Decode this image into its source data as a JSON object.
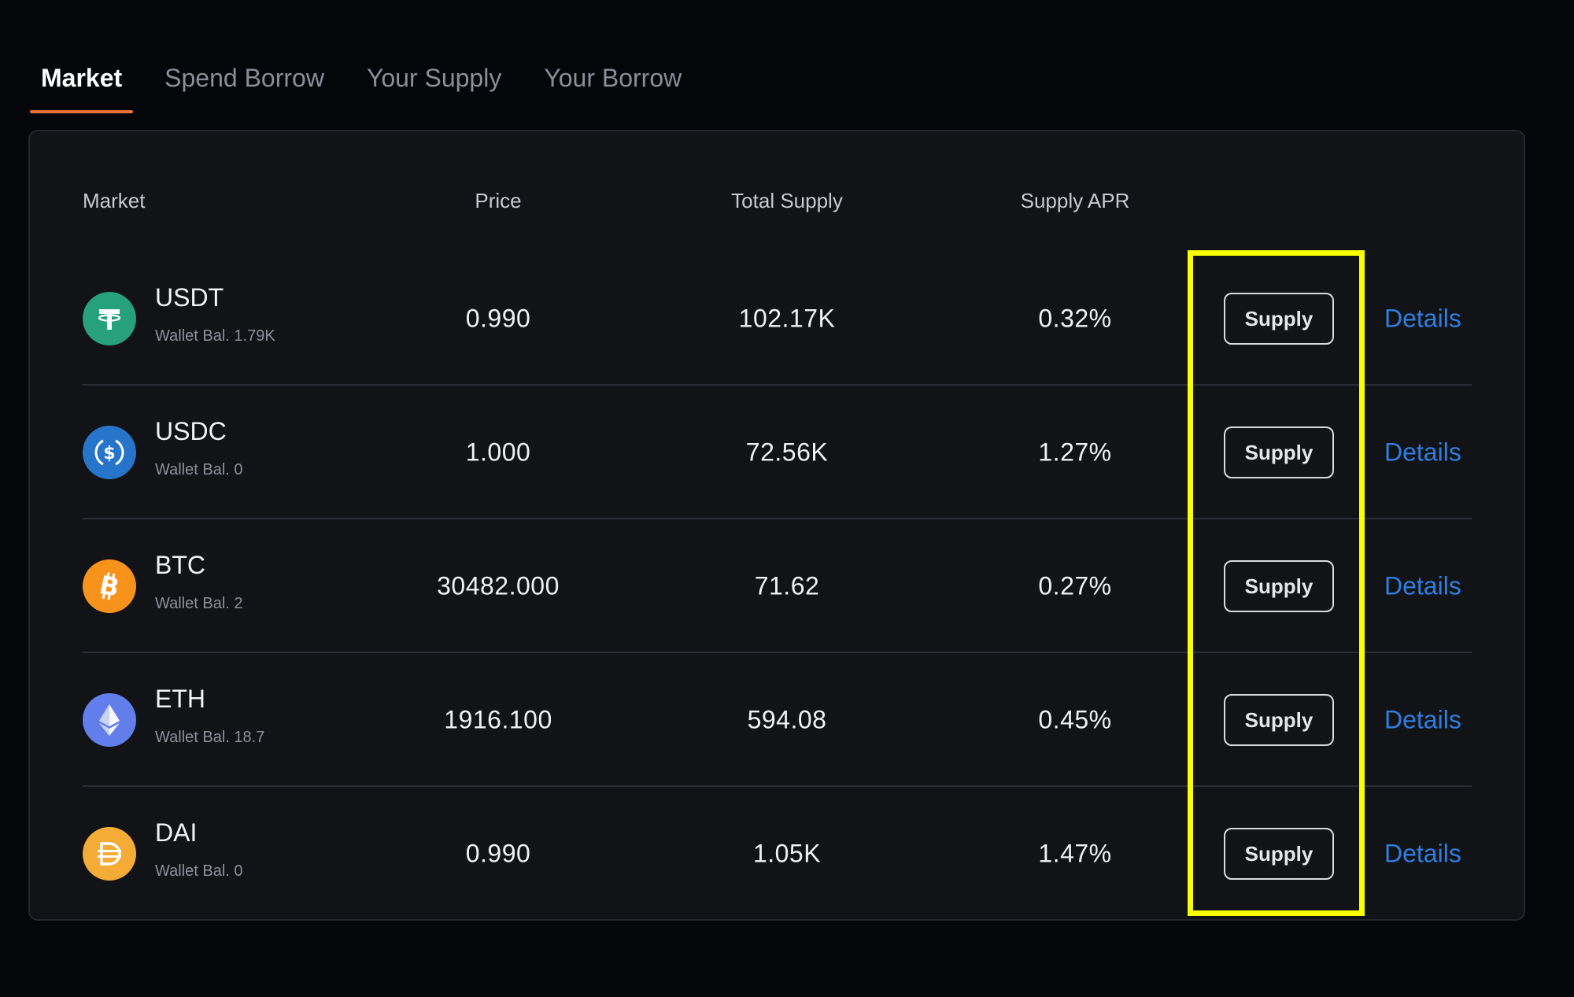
{
  "tabs": [
    {
      "label": "Market",
      "active": true
    },
    {
      "label": "Spend Borrow",
      "active": false
    },
    {
      "label": "Your Supply",
      "active": false
    },
    {
      "label": "Your Borrow",
      "active": false
    }
  ],
  "table": {
    "headers": {
      "market": "Market",
      "price": "Price",
      "total_supply": "Total Supply",
      "supply_apr": "Supply APR"
    },
    "rows": [
      {
        "symbol": "USDT",
        "wallet": "Wallet Bal. 1.79K",
        "price": "0.990",
        "total_supply": "102.17K",
        "apr": "0.32%",
        "action": "Supply",
        "link": "Details",
        "icon": "tether-icon",
        "color": "#26a17b"
      },
      {
        "symbol": "USDC",
        "wallet": "Wallet Bal. 0",
        "price": "1.000",
        "total_supply": "72.56K",
        "apr": "1.27%",
        "action": "Supply",
        "link": "Details",
        "icon": "usdc-icon",
        "color": "#2775ca"
      },
      {
        "symbol": "BTC",
        "wallet": "Wallet Bal. 2",
        "price": "30482.000",
        "total_supply": "71.62",
        "apr": "0.27%",
        "action": "Supply",
        "link": "Details",
        "icon": "bitcoin-icon",
        "color": "#f7931a"
      },
      {
        "symbol": "ETH",
        "wallet": "Wallet Bal. 18.7",
        "price": "1916.100",
        "total_supply": "594.08",
        "apr": "0.45%",
        "action": "Supply",
        "link": "Details",
        "icon": "ethereum-icon",
        "color": "#627eea"
      },
      {
        "symbol": "DAI",
        "wallet": "Wallet Bal. 0",
        "price": "0.990",
        "total_supply": "1.05K",
        "apr": "1.47%",
        "action": "Supply",
        "link": "Details",
        "icon": "dai-icon",
        "color": "#f5ac37"
      }
    ]
  },
  "colors": {
    "accent_tab": "#e8703a",
    "link": "#2f7fe0",
    "highlight": "#f7ff00",
    "card_bg": "#111317",
    "page_bg": "#05060a"
  }
}
